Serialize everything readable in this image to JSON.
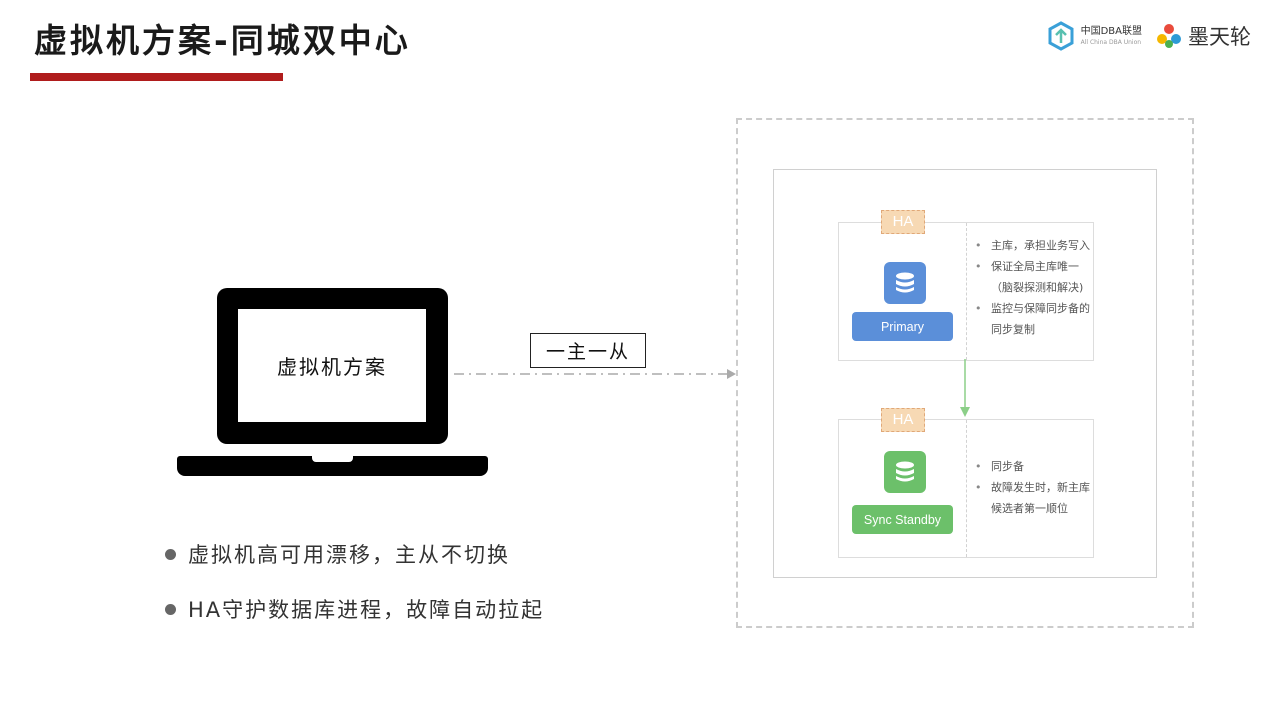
{
  "header": {
    "title": "虚拟机方案-同城双中心",
    "accent_color": "#b01c1c",
    "logos": [
      {
        "icon": "dba-alliance-logo-icon",
        "name": "中国DBA联盟",
        "sub": "All China DBA Union"
      },
      {
        "icon": "motianlun-logo-icon",
        "name": "墨天轮"
      }
    ]
  },
  "laptop": {
    "screen_text": "虚拟机方案"
  },
  "connector": {
    "label": "一主一从"
  },
  "bullets": [
    "虚拟机高可用漂移，主从不切换",
    "HA守护数据库进程，故障自动拉起"
  ],
  "nodes": [
    {
      "ha": "HA",
      "icon": "database-icon",
      "role": "Primary",
      "color": "#5b8fd9",
      "notes": [
        "主库，承担业务写入",
        "保证全局主库唯一（脑裂探测和解决)",
        "监控与保障同步备的同步复制"
      ]
    },
    {
      "ha": "HA",
      "icon": "database-icon",
      "role": "Sync Standby",
      "color": "#6cc06a",
      "notes": [
        "同步备",
        "故障发生时，新主库候选者第一顺位"
      ]
    }
  ]
}
